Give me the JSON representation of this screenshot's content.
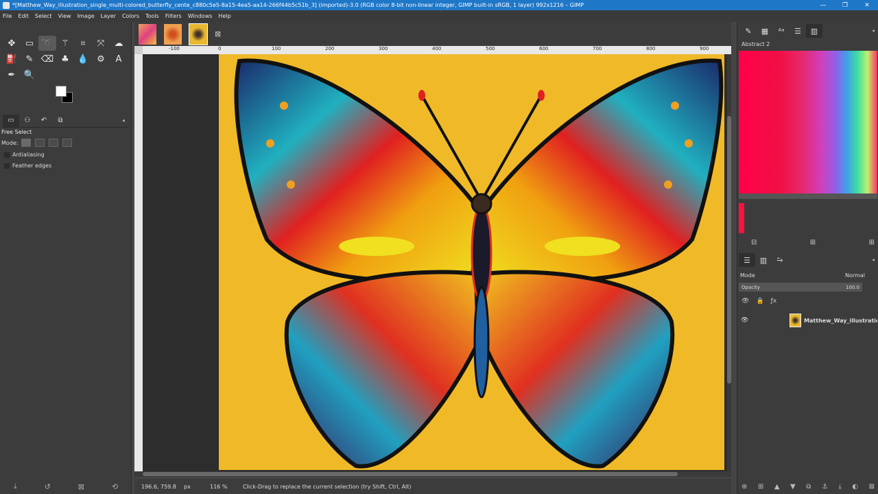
{
  "window": {
    "title": "*[Matthew_Way_illustration_single_multi-colored_butterfly_cente_c880c5e5-8a15-4ea5-aa14-266f44b5c51b_3] (imported)-3.0 (RGB color 8-bit non-linear integer, GIMP built-in sRGB, 1 layer) 992x1216 – GIMP",
    "minimize": "—",
    "maximize": "❐",
    "close": "✕"
  },
  "menu": [
    "File",
    "Edit",
    "Select",
    "View",
    "Image",
    "Layer",
    "Colors",
    "Tools",
    "Filters",
    "Windows",
    "Help"
  ],
  "toolbox": {
    "tool_options_title": "Free Select",
    "mode_label": "Mode:",
    "antialiasing_label": "Antialiasing",
    "feather_label": "Feather edges"
  },
  "rulers": {
    "top_ticks": [
      "-100",
      "0",
      "100",
      "200",
      "300",
      "400",
      "500",
      "600",
      "700",
      "800",
      "900"
    ]
  },
  "status": {
    "coords": "196.6, 759.8",
    "unit": "px",
    "zoom": "116 %",
    "message": "Click-Drag to replace the current selection (try Shift, Ctrl, Alt)"
  },
  "right_dock": {
    "gradient_name": "Abstract 2",
    "mode_label": "Mode",
    "mode_value": "Normal",
    "opacity_label": "Opacity",
    "opacity_value": "100.0",
    "layer_name": "Matthew_Way_illustration_sin"
  },
  "colors": {
    "canvas_bg": "#f0b928",
    "titlebar": "#1f77c8"
  }
}
